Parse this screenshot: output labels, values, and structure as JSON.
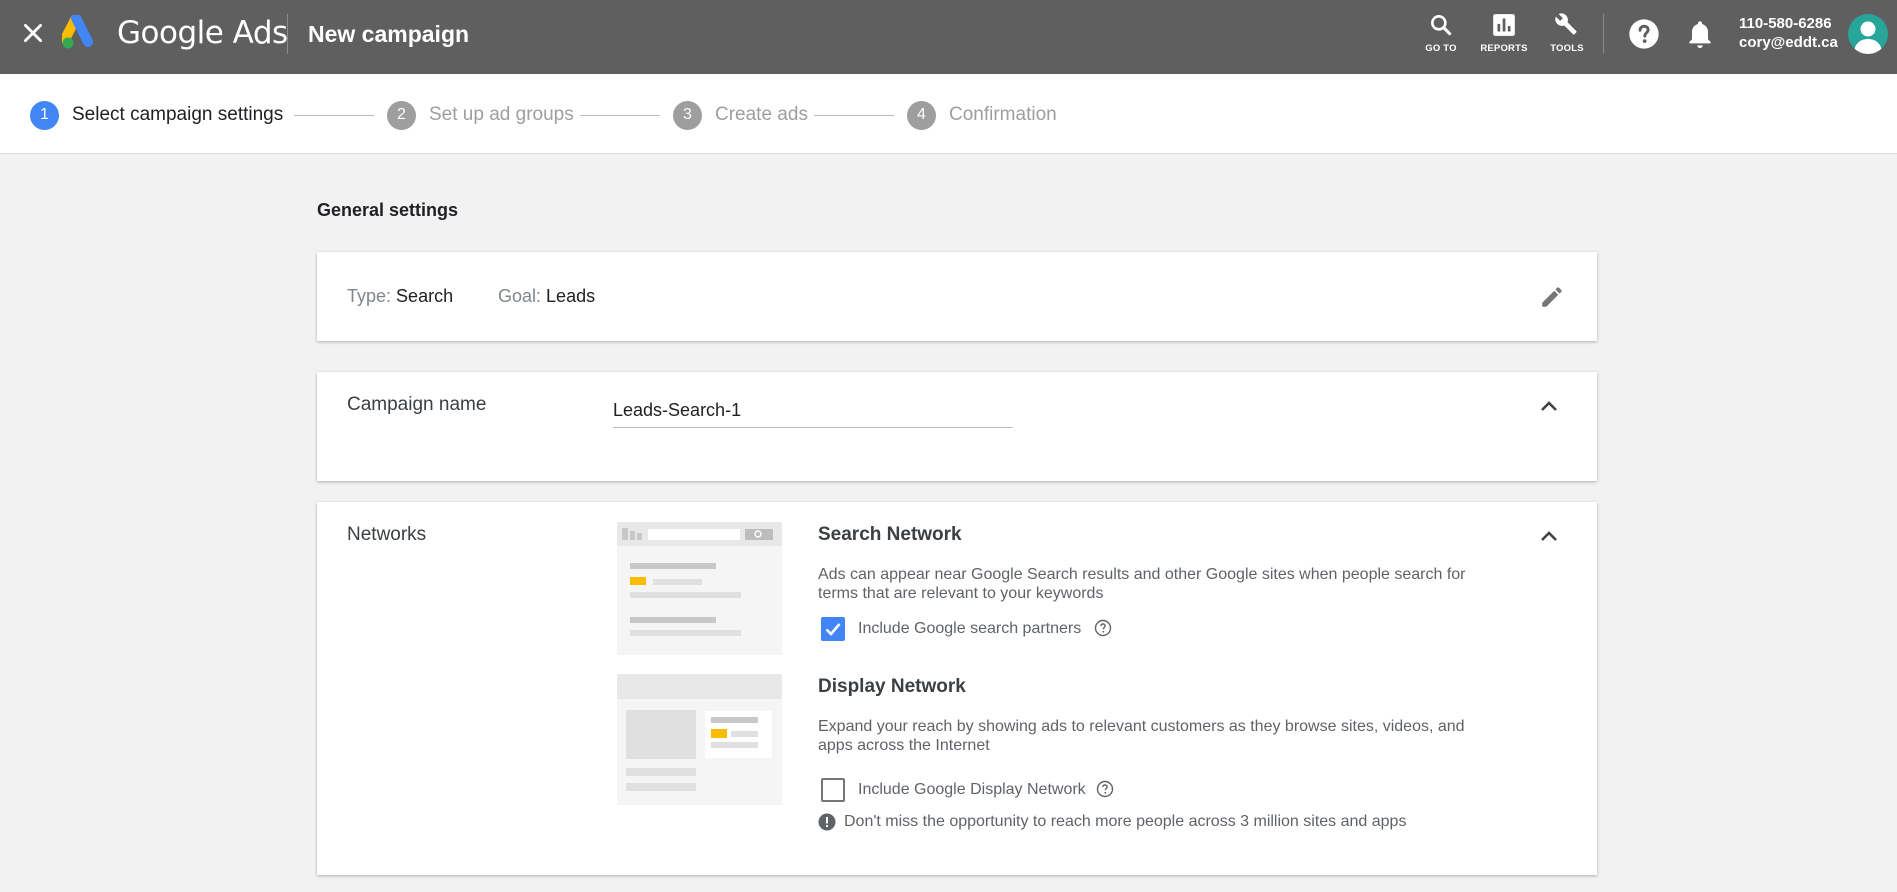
{
  "header": {
    "brand": "Google Ads",
    "title": "New campaign",
    "tools": [
      {
        "label": "GO TO",
        "icon": "search-icon"
      },
      {
        "label": "REPORTS",
        "icon": "reports-icon"
      },
      {
        "label": "TOOLS",
        "icon": "wrench-icon"
      }
    ],
    "account_id": "110-580-6286",
    "account_email": "cory@eddt.ca"
  },
  "steps": [
    {
      "num": "1",
      "label": "Select campaign settings",
      "active": true
    },
    {
      "num": "2",
      "label": "Set up ad groups",
      "active": false
    },
    {
      "num": "3",
      "label": "Create ads",
      "active": false
    },
    {
      "num": "4",
      "label": "Confirmation",
      "active": false
    }
  ],
  "general": {
    "section_title": "General settings",
    "type_key": "Type:",
    "type_value": "Search",
    "goal_key": "Goal:",
    "goal_value": "Leads"
  },
  "campaign_name": {
    "label": "Campaign name",
    "value": "Leads-Search-1"
  },
  "networks": {
    "label": "Networks",
    "search": {
      "title": "Search Network",
      "description": "Ads can appear near Google Search results and other Google sites when people search for terms that are relevant to your keywords",
      "checkbox_label": "Include Google search partners",
      "checked": true
    },
    "display": {
      "title": "Display Network",
      "description": "Expand your reach by showing ads to relevant customers as they browse sites, videos, and apps across the Internet",
      "checkbox_label": "Include Google Display Network",
      "checked": false
    },
    "info_message": "Don't miss the opportunity to reach more people across 3 million sites and apps"
  },
  "colors": {
    "topbar": "#5f5f5f",
    "accent": "#4285f4",
    "ad_highlight": "#fbbc04"
  }
}
